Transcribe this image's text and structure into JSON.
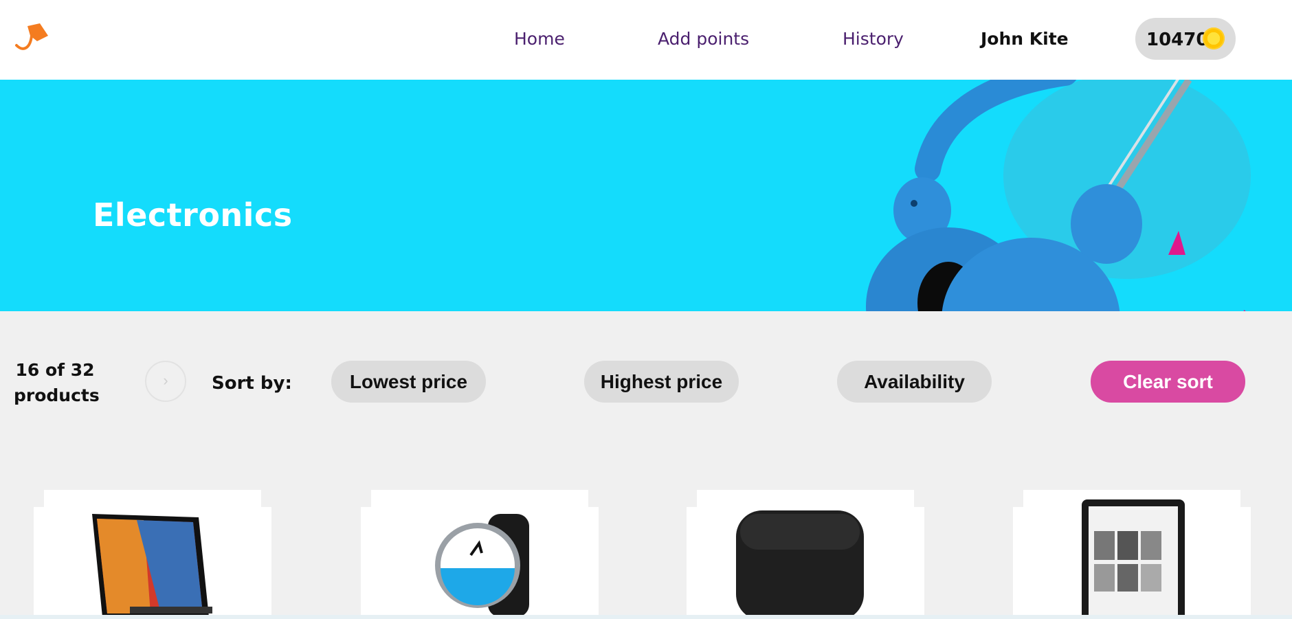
{
  "header": {
    "nav": [
      {
        "label": "Home"
      },
      {
        "label": "Add points"
      },
      {
        "label": "History"
      }
    ],
    "user_name": "John Kite",
    "points": "10470",
    "icons": {
      "logo": "bag-logo-icon",
      "coin": "coin-icon"
    }
  },
  "hero": {
    "title": "Electronics",
    "background_color": "#14dcfc"
  },
  "toolbar": {
    "count_line1": "16 of 32",
    "count_line2": "products",
    "sort_label": "Sort by:",
    "sort_options": [
      {
        "label": "Lowest price"
      },
      {
        "label": "Highest price"
      },
      {
        "label": "Availability"
      }
    ],
    "clear_label": "Clear sort",
    "accent_color": "#d94aa2"
  },
  "products": [
    {
      "image": "tablet-product-image"
    },
    {
      "image": "smartwatch-product-image"
    },
    {
      "image": "speaker-product-image"
    },
    {
      "image": "ereader-product-image"
    }
  ]
}
